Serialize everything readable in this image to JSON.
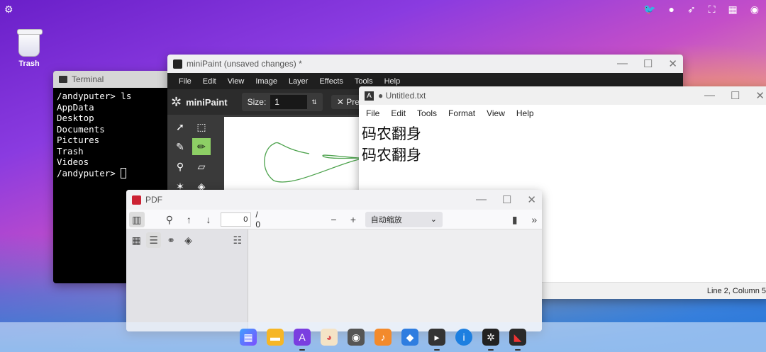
{
  "topbar": {
    "left_icon": "network-icon",
    "right_icons": [
      "twitter-icon",
      "github-icon",
      "rocket-icon",
      "fullscreen-icon",
      "qr-icon",
      "user-icon"
    ]
  },
  "desktop": {
    "trash_label": "Trash"
  },
  "terminal": {
    "title": "Terminal",
    "lines": [
      "/andyputer> ls",
      "AppData",
      "Desktop",
      "Documents",
      "Pictures",
      "Trash",
      "Videos",
      "/andyputer> "
    ]
  },
  "minipaint": {
    "title": "miniPaint (unsaved changes) *",
    "menu": [
      "File",
      "Edit",
      "View",
      "Image",
      "Layer",
      "Effects",
      "Tools",
      "Help"
    ],
    "logo": "miniPaint",
    "size_label": "Size:",
    "size_value": "1",
    "pressure_label": "Pressu"
  },
  "notepad": {
    "title": "● Untitled.txt",
    "menu": [
      "File",
      "Edit",
      "Tools",
      "Format",
      "View",
      "Help"
    ],
    "lines": [
      "码农翻身",
      "码农翻身"
    ],
    "status": "Line 2, Column 5"
  },
  "pdf": {
    "title": "PDF",
    "page_value": "0",
    "page_total": "/ 0",
    "zoom": "自动缩放"
  },
  "colors": {
    "paint_active_tool": "#8dcf65",
    "terminal_bg": "#000000"
  }
}
